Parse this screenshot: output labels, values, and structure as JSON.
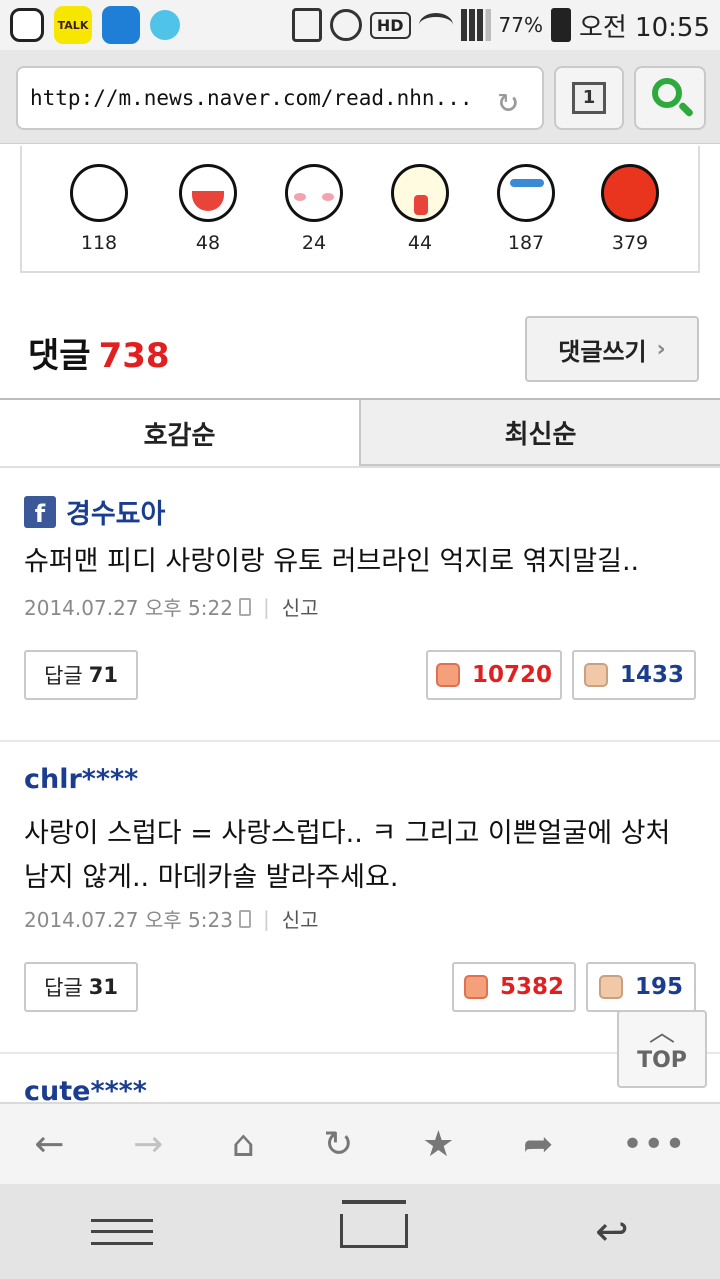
{
  "status_bar": {
    "battery": "77%",
    "time": "오전 10:55",
    "hd_label": "HD",
    "apps": [
      "TALK"
    ]
  },
  "browser": {
    "url": "http://m.news.naver.com/read.nhn...",
    "tab_count": "1"
  },
  "reactions": [
    {
      "icon": "like-face-icon",
      "count": "118"
    },
    {
      "icon": "laugh-face-icon",
      "count": "48"
    },
    {
      "icon": "shy-face-icon",
      "count": "24"
    },
    {
      "icon": "shock-face-icon",
      "count": "44"
    },
    {
      "icon": "cry-face-icon",
      "count": "187"
    },
    {
      "icon": "angry-face-icon",
      "count": "379"
    }
  ],
  "comments_header": {
    "label": "댓글",
    "count": "738",
    "write_label": "댓글쓰기"
  },
  "sort_tabs": {
    "popular": "호감순",
    "latest": "최신순"
  },
  "comments": [
    {
      "author": "경수됴아",
      "text": "슈퍼맨 피디 사랑이랑 유토 러브라인 억지로 엮지말길..",
      "date": "2014.07.27 오후 5:22",
      "report": "신고",
      "reply_label": "답글",
      "reply_count": "71",
      "likes": "10720",
      "dislikes": "1433"
    },
    {
      "author": "chlr****",
      "text": "사랑이 스럽다 = 사랑스럽다.. ㅋ 그리고 이쁜얼굴에 상처남지 않게.. 마데카솔 발라주세요.",
      "date": "2014.07.27 오후 5:23",
      "report": "신고",
      "reply_label": "답글",
      "reply_count": "31",
      "likes": "5382",
      "dislikes": "195"
    },
    {
      "author": "cute****"
    }
  ],
  "top_button": "TOP",
  "colors": {
    "accent_red": "#e02020",
    "author_blue": "#1a3d8f",
    "facebook": "#3b5998"
  }
}
